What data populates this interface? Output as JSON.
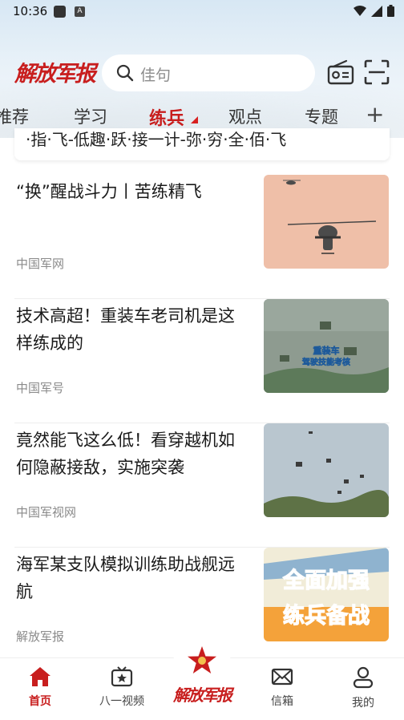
{
  "status_bar": {
    "time": "10:36",
    "a_icon": "A"
  },
  "header": {
    "logo_text": "解放军报",
    "search_placeholder": "佳句"
  },
  "tabs": [
    {
      "label": "推荐",
      "active": false
    },
    {
      "label": "学习",
      "active": false
    },
    {
      "label": "练兵",
      "active": true
    },
    {
      "label": "观点",
      "active": false
    },
    {
      "label": "专题",
      "active": false
    }
  ],
  "add_tab_label": "+",
  "peek_card": {
    "text": "·指·飞-低趣·跃·接一计-弥·穷·全·佰·飞"
  },
  "news": [
    {
      "title": "“换”醒战斗力丨苦练精飞",
      "source": "中国军网",
      "thumb": "helicopter"
    },
    {
      "title": "技术高超！重装车老司机是这样练成的",
      "source": "中国军号",
      "thumb": "trucks",
      "overlay": "重装车\n驾驶技能考核"
    },
    {
      "title": "竟然能飞这么低！看穿越机如何隐蔽接敌，实施突袭",
      "source": "中国军视网",
      "thumb": "drones"
    },
    {
      "title": "海军某支队模拟训练助战舰远航",
      "source": "解放军报",
      "thumb": "poster",
      "overlay1": "全面加强",
      "overlay2": "练兵备战"
    }
  ],
  "bottom_nav": [
    {
      "label": "首页",
      "icon": "home-icon",
      "active": true
    },
    {
      "label": "八一视频",
      "icon": "tv-star-icon",
      "active": false
    },
    {
      "label": "解放军报",
      "icon": "army-logo-icon",
      "active": false
    },
    {
      "label": "信箱",
      "icon": "mail-icon",
      "active": false
    },
    {
      "label": "我的",
      "icon": "person-icon",
      "active": false
    }
  ],
  "colors": {
    "accent": "#c81e1e"
  }
}
